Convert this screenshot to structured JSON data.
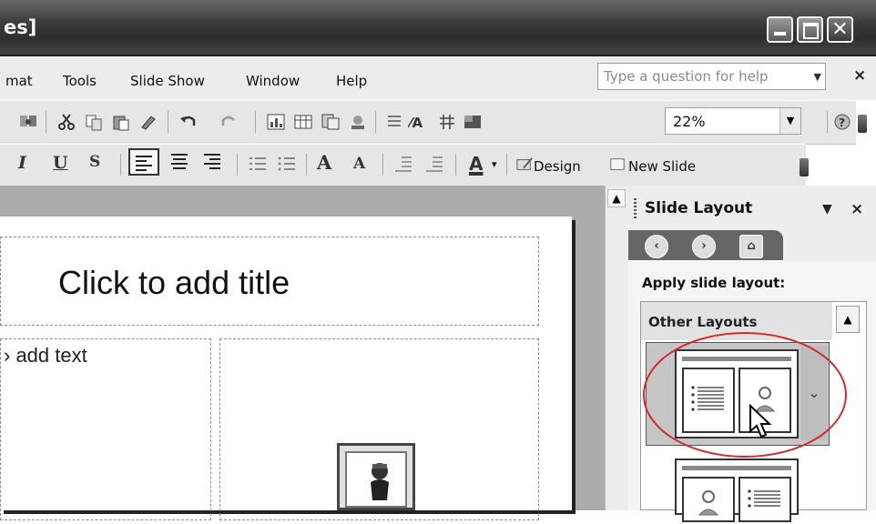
{
  "window": {
    "title": "es]",
    "controls": {
      "minimize": "minimize",
      "maximize": "maximize",
      "close": "✕"
    }
  },
  "menubar": {
    "items": [
      {
        "label": "mat"
      },
      {
        "label": "Tools"
      },
      {
        "label": "Slide Show"
      },
      {
        "label": "Window"
      },
      {
        "label": "Help"
      }
    ],
    "help_placeholder": "Type a question for help",
    "close": "×"
  },
  "standard_toolbar": {
    "zoom": "22%",
    "icons": [
      "research-icon",
      "cut-icon",
      "copy-icon",
      "paste-icon",
      "format-painter-icon",
      "undo-icon",
      "redo-icon",
      "insert-chart-icon",
      "insert-table-icon",
      "tables-borders-icon",
      "color-grayscale-icon",
      "expand-all-icon",
      "show-formatting-icon",
      "show-grid-icon",
      "grayscale-icon",
      "help-icon"
    ]
  },
  "formatting_toolbar": {
    "italic": "I",
    "underline": "U",
    "shadow": "S",
    "increase_font": "A",
    "decrease_font": "A",
    "font_color": "A",
    "design_label": "Design",
    "new_slide_label": "New Slide"
  },
  "slide": {
    "title_placeholder": "Click to add title",
    "body_placeholder": "› add text"
  },
  "task_pane": {
    "title": "Slide Layout",
    "menu": "▼",
    "close": "×",
    "nav": {
      "back": "‹",
      "forward": "›",
      "home": "⌂"
    },
    "apply_label": "Apply slide layout:",
    "section_label": "Other Layouts",
    "selected_layout_dropdown": "⌄",
    "accent_color": "#d22a2a"
  }
}
